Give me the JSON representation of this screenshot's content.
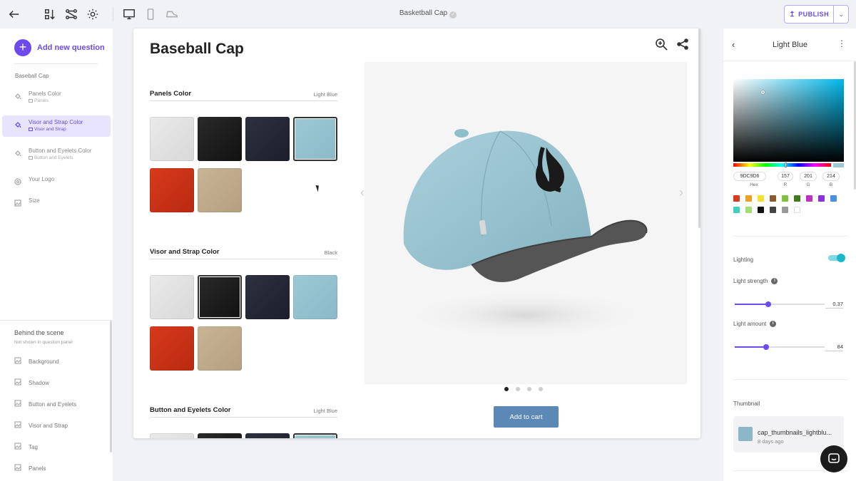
{
  "toolbar": {
    "back_icon": "arrow-left-icon",
    "doc_title": "Basketball Cap",
    "publish_label": "PUBLISH"
  },
  "left_panel": {
    "add_question_label": "Add new question",
    "section_title": "Baseball Cap",
    "questions": [
      {
        "name": "Panels Color",
        "sub": "Panels",
        "active": false
      },
      {
        "name": "Visor and Strap Color",
        "sub": "Visor and Strap",
        "active": true
      },
      {
        "name": "Button and Eyelets Color",
        "sub": "Button and Eyelets",
        "active": false
      },
      {
        "name": "Your Logo",
        "sub": "",
        "active": false
      },
      {
        "name": "Size",
        "sub": "",
        "active": false
      }
    ],
    "behind": {
      "title": "Behind the scene",
      "note": "Not shown in question panel",
      "items": [
        "Background",
        "Shadow",
        "Button and Eyelets",
        "Visor and Strap",
        "Tag",
        "Panels"
      ]
    }
  },
  "product": {
    "title": "Baseball Cap",
    "add_to_cart_label": "Add to cart",
    "questions": [
      {
        "title": "Panels Color",
        "value": "Light Blue",
        "selected": "blue"
      },
      {
        "title": "Visor and Strap Color",
        "value": "Black",
        "selected": "black"
      },
      {
        "title": "Button and Eyelets Color",
        "value": "Light Blue",
        "selected": "blue"
      }
    ],
    "swatch_colors": [
      "white",
      "black",
      "navy",
      "blue",
      "red",
      "beige"
    ],
    "carousel_dots": 4,
    "active_dot": 0
  },
  "right_panel": {
    "title": "Light Blue",
    "hex_value": "9DC9D6",
    "r_value": "157",
    "g_value": "201",
    "b_value": "214",
    "hex_label": "Hex",
    "r_label": "R",
    "g_label": "G",
    "b_label": "B",
    "current_color": "#9dc9d6",
    "palette": [
      "#d83a1c",
      "#f0a020",
      "#f3e030",
      "#8a5a2c",
      "#80c040",
      "#3f7a1c",
      "#c030c0",
      "#8a30e0",
      "#4a90e0",
      "#40d0c0",
      "#a0e070",
      "#111111",
      "#444444",
      "#999999",
      "#ffffff"
    ],
    "lighting_label": "Lighting",
    "lighting_on": true,
    "light_strength_label": "Light strength",
    "light_strength_value": "0.37",
    "light_strength_fraction": 0.37,
    "light_amount_label": "Light amount",
    "light_amount_value": "84",
    "light_amount_fraction": 0.35,
    "thumbnail_label": "Thumbnail",
    "thumbnail_name": "cap_thumbnails_lightblu...",
    "thumbnail_date": "8 days ago"
  }
}
